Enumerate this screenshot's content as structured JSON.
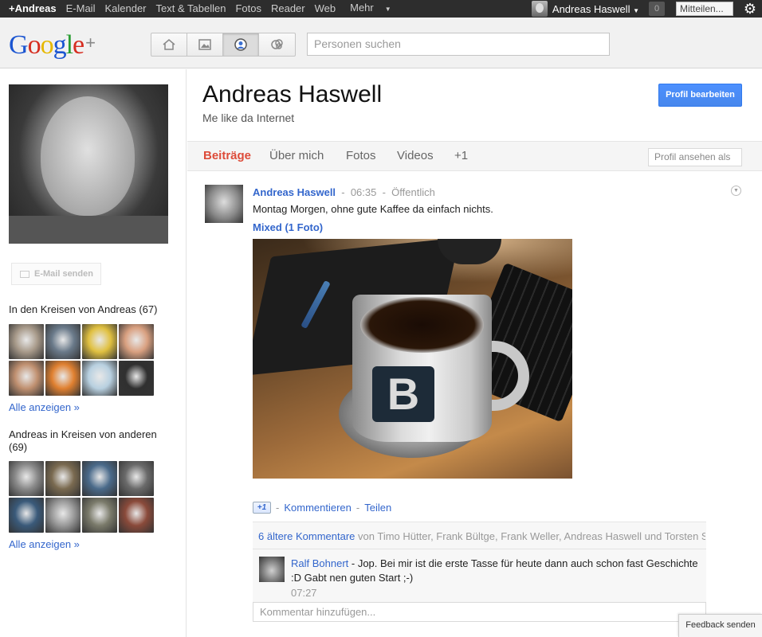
{
  "topbar": {
    "items": [
      "+Andreas",
      "E-Mail",
      "Kalender",
      "Text & Tabellen",
      "Fotos",
      "Reader",
      "Web",
      "Mehr"
    ],
    "user_name": "Andreas Haswell",
    "notification_count": "0",
    "share_label": "Mitteilen...",
    "settings_icon": "gear-icon"
  },
  "header": {
    "logo_text": "Google",
    "logo_plus": "+",
    "nav_icons": [
      "home-icon",
      "photos-icon",
      "profile-icon",
      "circles-icon"
    ],
    "search_placeholder": "Personen suchen"
  },
  "sidebar": {
    "email_button": "E-Mail senden",
    "circles_in_title": "In den Kreisen von Andreas (67)",
    "circles_in_show_all": "Alle anzeigen »",
    "circles_of_title": "Andreas in Kreisen von anderen (69)",
    "circles_of_show_all": "Alle anzeigen »",
    "circles_in_colors": [
      "#a89a8a",
      "#6a7a8a",
      "#e0c040",
      "#d9a080",
      "#c09070",
      "#e08030",
      "#b8d0e0",
      "#303030"
    ],
    "circles_of_colors": [
      "#8a8a8a",
      "#7a6a50",
      "#4a6a8a",
      "#6a6a6a",
      "#3a5a7a",
      "#9a9a9a",
      "#7a7a6a",
      "#8a4a3a"
    ]
  },
  "profile": {
    "name": "Andreas Haswell",
    "tagline": "Me like da Internet",
    "edit_button": "Profil bearbeiten",
    "tabs": [
      "Beiträge",
      "Über mich",
      "Fotos",
      "Videos",
      "+1"
    ],
    "view_as": "Profil ansehen als"
  },
  "post": {
    "author": "Andreas Haswell",
    "time": "06:35",
    "visibility": "Öffentlich",
    "text": "Montag Morgen, ohne gute Kaffee da einfach nichts.",
    "album": "Mixed (1 Foto)",
    "plus_one": "+1",
    "comment_link": "Kommentieren",
    "share_link": "Teilen",
    "older_comments": "6 ältere Kommentare",
    "older_by": "von Timo Hütter, Frank Bültge, Frank Weller, Andreas Haswell und Torsten S",
    "comment": {
      "author": "Ralf Bohnert",
      "text": " - Jop. Bei mir ist die erste Tasse für heute dann auch schon fast Geschichte :D Gabt nen guten Start ;-)",
      "time": "07:27"
    },
    "add_comment_placeholder": "Kommentar hinzufügen..."
  },
  "feedback": "Feedback senden"
}
